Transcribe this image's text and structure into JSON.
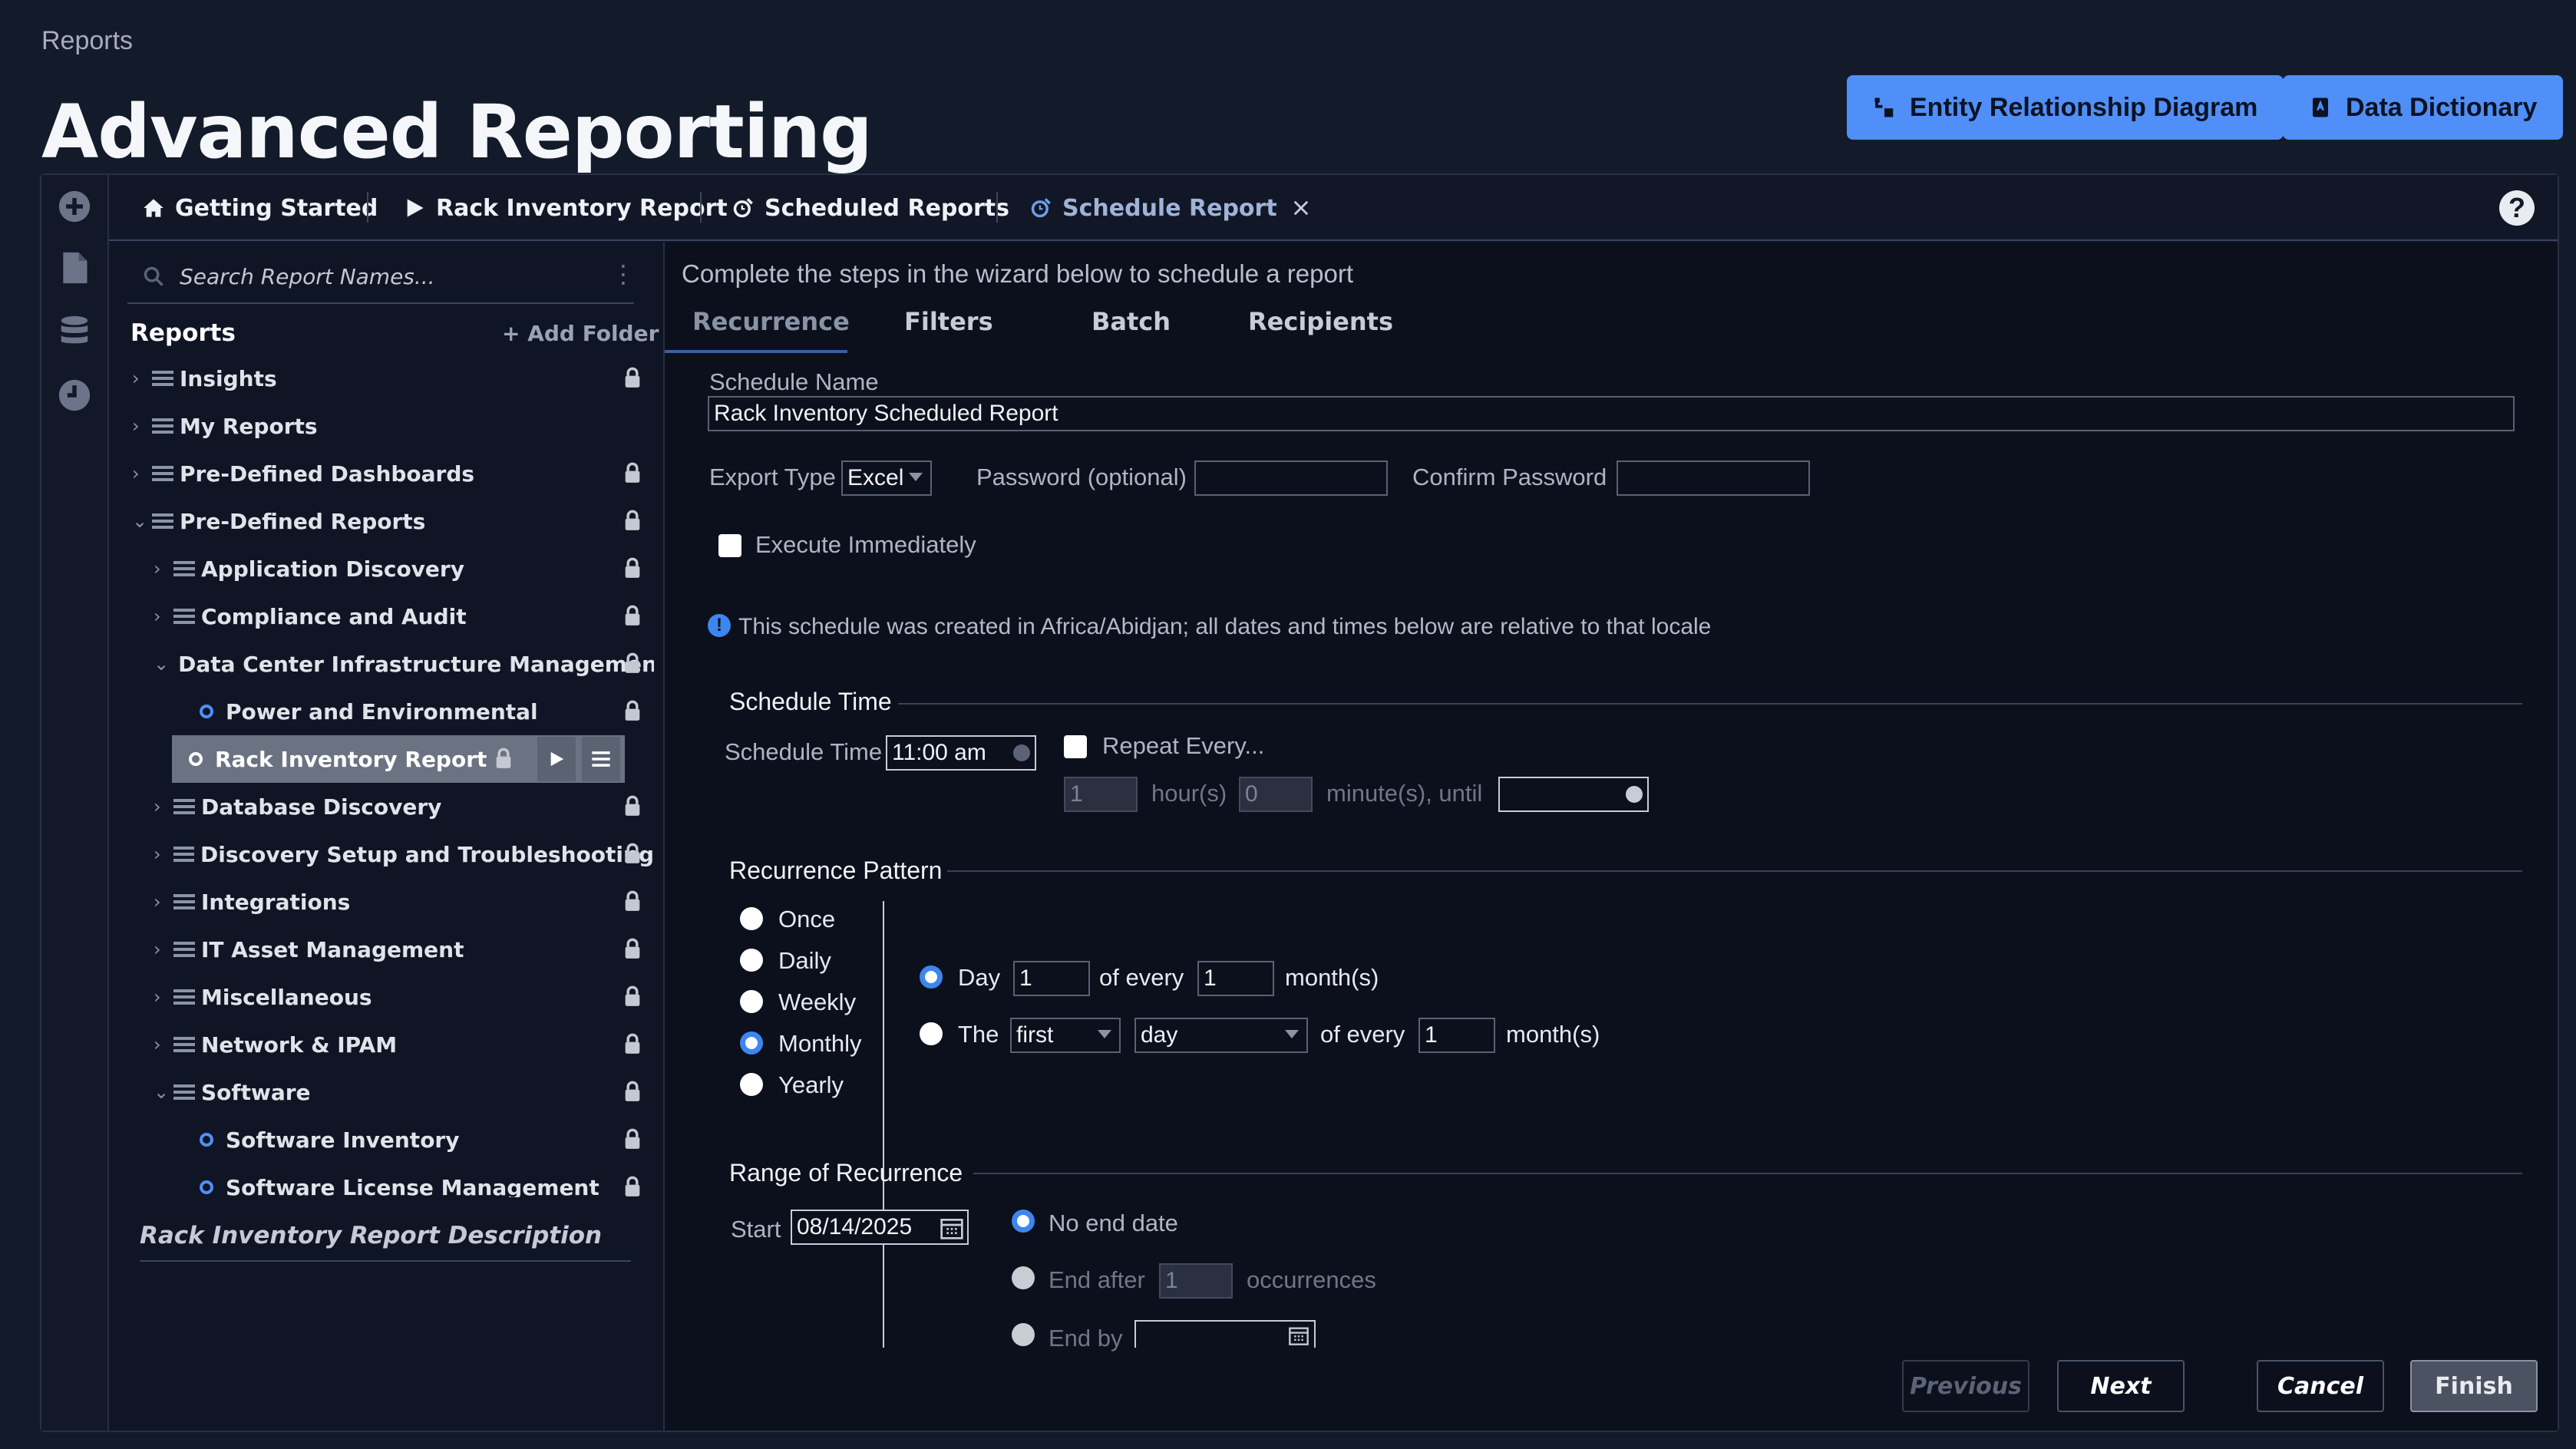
{
  "breadcrumb": "Reports",
  "page_title": "Advanced Reporting",
  "header_buttons": {
    "erd": "Entity Relationship Diagram",
    "dictionary": "Data Dictionary"
  },
  "tabs": [
    {
      "label": "Getting Started",
      "icon": "home-icon"
    },
    {
      "label": "Rack Inventory Report",
      "icon": "play-icon"
    },
    {
      "label": "Scheduled Reports",
      "icon": "schedule-icon"
    },
    {
      "label": "Schedule Report",
      "icon": "schedule-icon",
      "active": true
    }
  ],
  "left": {
    "search_placeholder": "Search Report Names...",
    "reports_heading": "Reports",
    "add_folder": "+ Add Folder",
    "tree": [
      {
        "label": "Insights",
        "type": "folder",
        "level": 0,
        "expanded": false,
        "locked": true
      },
      {
        "label": "My Reports",
        "type": "folder",
        "level": 0,
        "expanded": false,
        "locked": false
      },
      {
        "label": "Pre-Defined Dashboards",
        "type": "folder",
        "level": 0,
        "expanded": false,
        "locked": true
      },
      {
        "label": "Pre-Defined Reports",
        "type": "folder",
        "level": 0,
        "expanded": true,
        "locked": true
      },
      {
        "label": "Application Discovery",
        "type": "folder",
        "level": 1,
        "expanded": false,
        "locked": true
      },
      {
        "label": "Compliance and Audit",
        "type": "folder",
        "level": 1,
        "expanded": false,
        "locked": true
      },
      {
        "label": "Data Center Infrastructure Management",
        "type": "folder",
        "level": 1,
        "expanded": true,
        "locked": true
      },
      {
        "label": "Power and Environmental",
        "type": "report",
        "level": 2,
        "locked": true
      },
      {
        "label": "Rack Inventory Report",
        "type": "report",
        "level": 2,
        "locked": true,
        "selected": true
      },
      {
        "label": "Database Discovery",
        "type": "folder",
        "level": 1,
        "expanded": false,
        "locked": true
      },
      {
        "label": "Discovery Setup and Troubleshooting",
        "type": "folder",
        "level": 1,
        "expanded": false,
        "locked": true
      },
      {
        "label": "Integrations",
        "type": "folder",
        "level": 1,
        "expanded": false,
        "locked": true
      },
      {
        "label": "IT Asset Management",
        "type": "folder",
        "level": 1,
        "expanded": false,
        "locked": true
      },
      {
        "label": "Miscellaneous",
        "type": "folder",
        "level": 1,
        "expanded": false,
        "locked": true
      },
      {
        "label": "Network & IPAM",
        "type": "folder",
        "level": 1,
        "expanded": false,
        "locked": true
      },
      {
        "label": "Software",
        "type": "folder",
        "level": 1,
        "expanded": true,
        "locked": true
      },
      {
        "label": "Software Inventory",
        "type": "report",
        "level": 2,
        "locked": true
      },
      {
        "label": "Software License Management",
        "type": "report",
        "level": 2,
        "locked": true
      }
    ],
    "description_heading": "Rack Inventory Report Description"
  },
  "wizard": {
    "intro": "Complete the steps in the wizard below to schedule a report",
    "steps": [
      "Recurrence",
      "Filters",
      "Batch",
      "Recipients"
    ],
    "schedule_name_label": "Schedule Name",
    "schedule_name_value": "Rack Inventory Scheduled Report",
    "export_type_label": "Export Type",
    "export_type_value": "Excel",
    "password_label": "Password (optional)",
    "confirm_password_label": "Confirm Password",
    "execute_immediately": "Execute Immediately",
    "timezone_note": "This schedule was created in Africa/Abidjan; all dates and times below are relative to that locale",
    "schedule_time_section": "Schedule Time",
    "schedule_time_label": "Schedule Time",
    "schedule_time_value": "11:00 am",
    "repeat_every": "Repeat Every...",
    "repeat_hours_value": "1",
    "hours_label": "hour(s)",
    "repeat_minutes_value": "0",
    "minutes_until_label": "minute(s), until",
    "recurrence_section": "Recurrence Pattern",
    "patterns": [
      "Once",
      "Daily",
      "Weekly",
      "Monthly",
      "Yearly"
    ],
    "selected_pattern": "Monthly",
    "day_label": "Day",
    "day_value": "1",
    "of_every": "of every",
    "every_months_value": "1",
    "months_label": "month(s)",
    "the_label": "The",
    "ordinal_value": "first",
    "weekday_value": "day",
    "of_every_2": "of every",
    "every_months_value_2": "1",
    "months_label_2": "month(s)",
    "range_section": "Range of Recurrence",
    "start_label": "Start",
    "start_value": "08/14/2025",
    "no_end_date": "No end date",
    "end_after": "End after",
    "end_after_value": "1",
    "occurrences": "occurrences",
    "end_by": "End by"
  },
  "footer": {
    "previous": "Previous",
    "next": "Next",
    "cancel": "Cancel",
    "finish": "Finish"
  },
  "colors": {
    "accent": "#4f8ff7",
    "background": "#131a2a",
    "panel": "#0b101c"
  }
}
